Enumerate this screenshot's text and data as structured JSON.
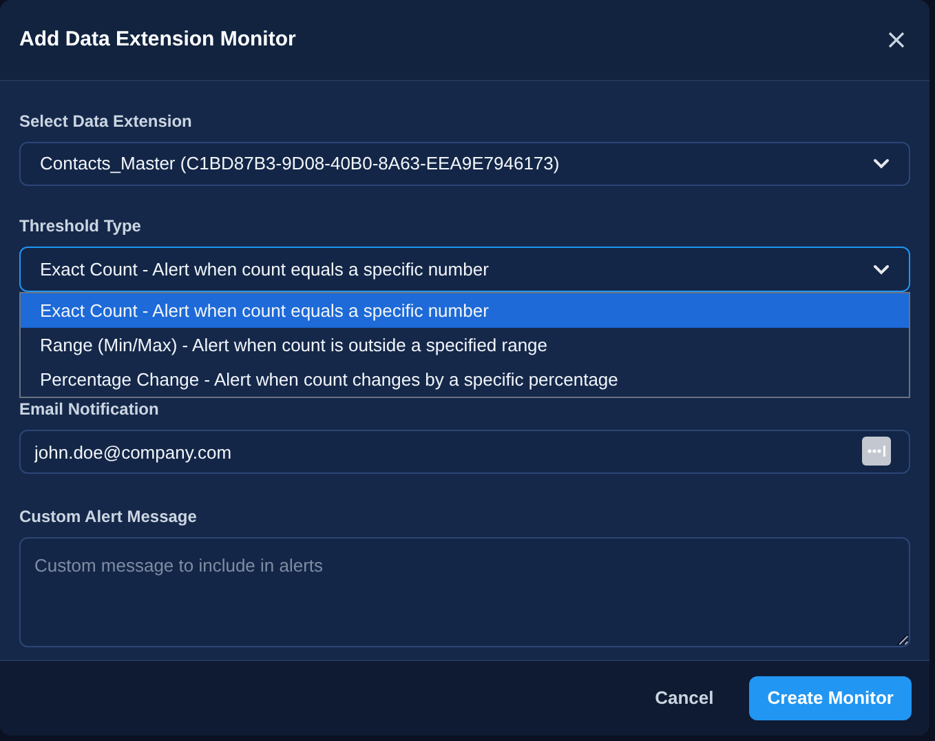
{
  "dialog": {
    "title": "Add Data Extension Monitor"
  },
  "data_extension": {
    "label": "Select Data Extension",
    "value": "Contacts_Master (C1BD87B3-9D08-40B0-8A63-EEA9E7946173)"
  },
  "threshold_type": {
    "label": "Threshold Type",
    "value": "Exact Count - Alert when count equals a specific number",
    "expanded": true,
    "options": [
      {
        "label": "Exact Count - Alert when count equals a specific number",
        "selected": true
      },
      {
        "label": "Range (Min/Max) - Alert when count is outside a specified range",
        "selected": false
      },
      {
        "label": "Percentage Change - Alert when count changes by a specific percentage",
        "selected": false
      }
    ]
  },
  "email": {
    "label": "Email Notification",
    "value": "john.doe@company.com"
  },
  "message": {
    "label": "Custom Alert Message",
    "placeholder": "Custom message to include in alerts"
  },
  "buttons": [
    {
      "label": "Cancel",
      "kind": "secondary"
    },
    {
      "label": "Create Monitor",
      "kind": "primary"
    }
  ]
}
